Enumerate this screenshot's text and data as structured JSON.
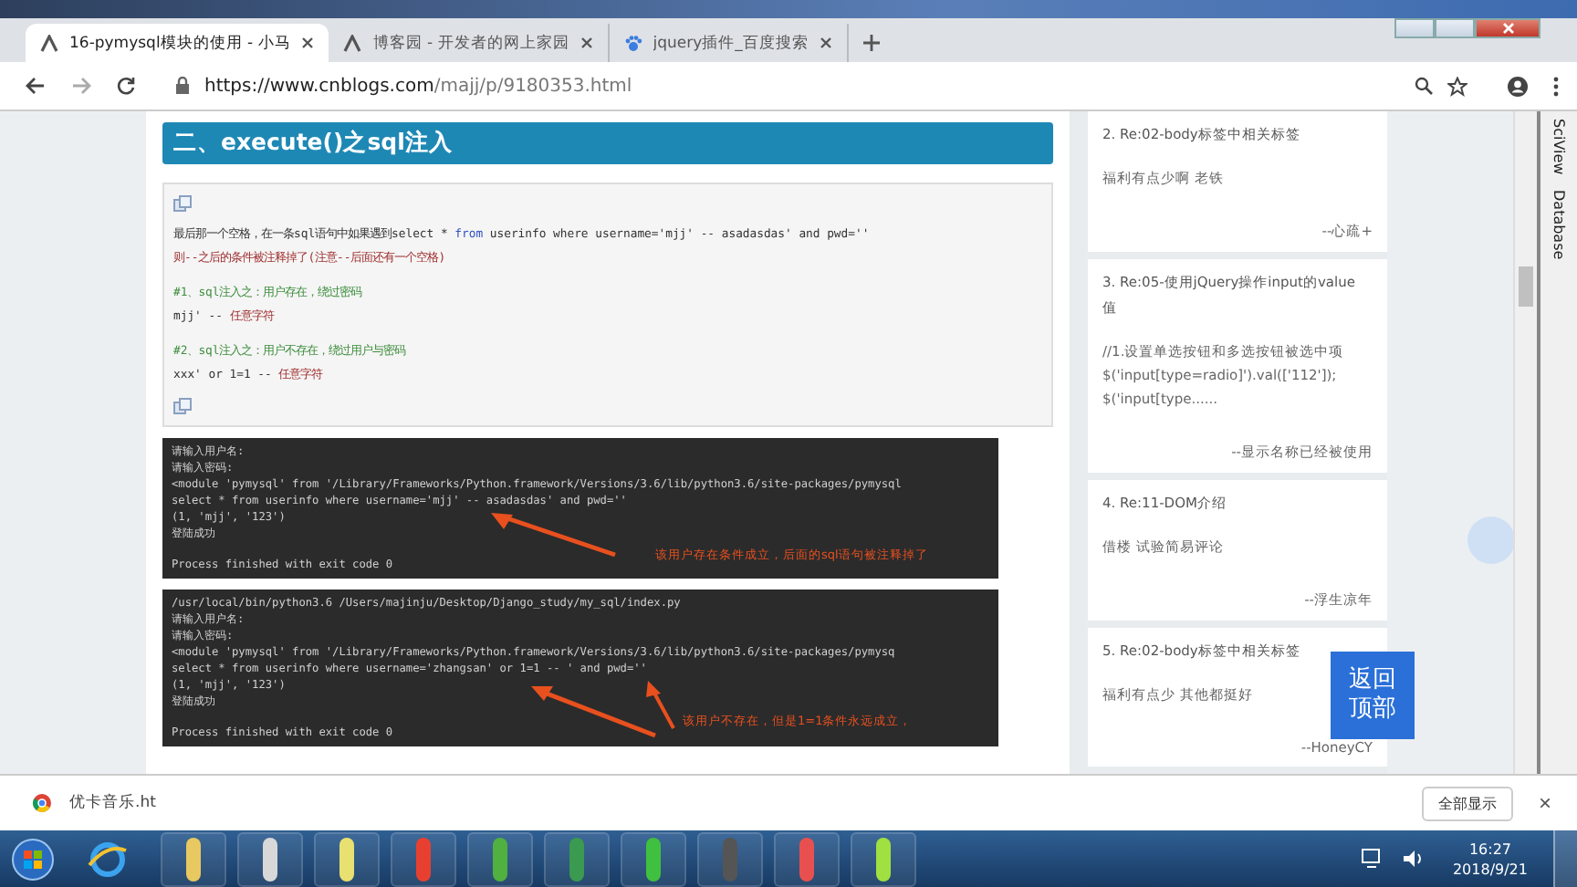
{
  "browser": {
    "tabs": [
      {
        "label": "16-pymysql模块的使用 - 小马",
        "selected": true,
        "kind": "blog"
      },
      {
        "label": "博客园 - 开发者的网上家园",
        "selected": false,
        "kind": "blog"
      },
      {
        "label": "jquery插件_百度搜索",
        "selected": false,
        "kind": "paw"
      }
    ],
    "url_host": "https://www.cnblogs.com",
    "url_path": "/majj/p/9180353.html"
  },
  "article": {
    "heading": "二、execute()之sql注入",
    "code_blocks": [
      [
        [
          {
            "kind": "plain",
            "text": "最后那一个空格，在一条sql语句中如果遇到select * "
          },
          {
            "kind": "keyword",
            "text": "from"
          },
          {
            "kind": "plain",
            "text": " userinfo where username='mjj' -- asadasdas' and pwd=''"
          }
        ],
        [
          {
            "kind": "note",
            "text": "则--之后的条件被注释掉了(注意--后面还有一个空格)"
          }
        ]
      ],
      [
        [
          {
            "kind": "comment",
            "text": "#1、sql注入之：用户存在，绕过密码"
          }
        ],
        [
          {
            "kind": "plain",
            "text": "mjj' -- "
          },
          {
            "kind": "note",
            "text": "任意字符"
          }
        ]
      ],
      [
        [
          {
            "kind": "comment",
            "text": "#2、sql注入之：用户不存在，绕过用户与密码"
          }
        ],
        [
          {
            "kind": "plain",
            "text": "xxx' or 1=1 -- "
          },
          {
            "kind": "note",
            "text": "任意字符"
          }
        ]
      ]
    ],
    "terminals": [
      {
        "lines": [
          "请输入用户名:",
          "请输入密码:",
          "<module 'pymysql' from '/Library/Frameworks/Python.framework/Versions/3.6/lib/python3.6/site-packages/pymysql",
          "select * from userinfo where username='mjj' -- asadasdas' and pwd=''",
          "(1, 'mjj', '123')",
          "登陆成功",
          "Process finished with exit code 0"
        ],
        "annotation": "该用户存在条件成立，后面的sql语句被注释掉了"
      },
      {
        "lines": [
          "/usr/local/bin/python3.6 /Users/majinju/Desktop/Django_study/my_sql/index.py",
          "请输入用户名:",
          "请输入密码:",
          "<module 'pymysql' from '/Library/Frameworks/Python.framework/Versions/3.6/lib/python3.6/site-packages/pymysq",
          "select * from userinfo where username='zhangsan' or 1=1 -- ' and pwd=''",
          "(1, 'mjj', '123')",
          "登陆成功",
          "Process finished with exit code 0"
        ],
        "annotation": "该用户不存在，但是1=1条件永远成立，"
      }
    ]
  },
  "comments": [
    {
      "title": "2. Re:02-body标签中相关标签",
      "body": [
        "福利有点少啊  老铁"
      ],
      "author": "--心疏+"
    },
    {
      "title": "3. Re:05-使用jQuery操作input的value值",
      "body": [
        "//1.设置单选按钮和多选按钮被选中项",
        "$('input[type=radio]').val(['112']);",
        "$('input[type......"
      ],
      "author": "--显示名称已经被使用"
    },
    {
      "title": "4. Re:11-DOM介绍",
      "body": [
        "借楼 试验简易评论"
      ],
      "author": "--浮生凉年"
    },
    {
      "title": "5. Re:02-body标签中相关标签",
      "body": [
        "福利有点少 其他都挺好"
      ],
      "author": "--HoneyCY"
    }
  ],
  "back_to_top": "返回顶部",
  "ide_panel": [
    "SciView",
    "Database"
  ],
  "download_bar": {
    "file": "优卡音乐.ht",
    "show_all": "全部显示",
    "close": "×"
  },
  "taskbar": {
    "time": "16:27",
    "date": "2018/9/21"
  }
}
